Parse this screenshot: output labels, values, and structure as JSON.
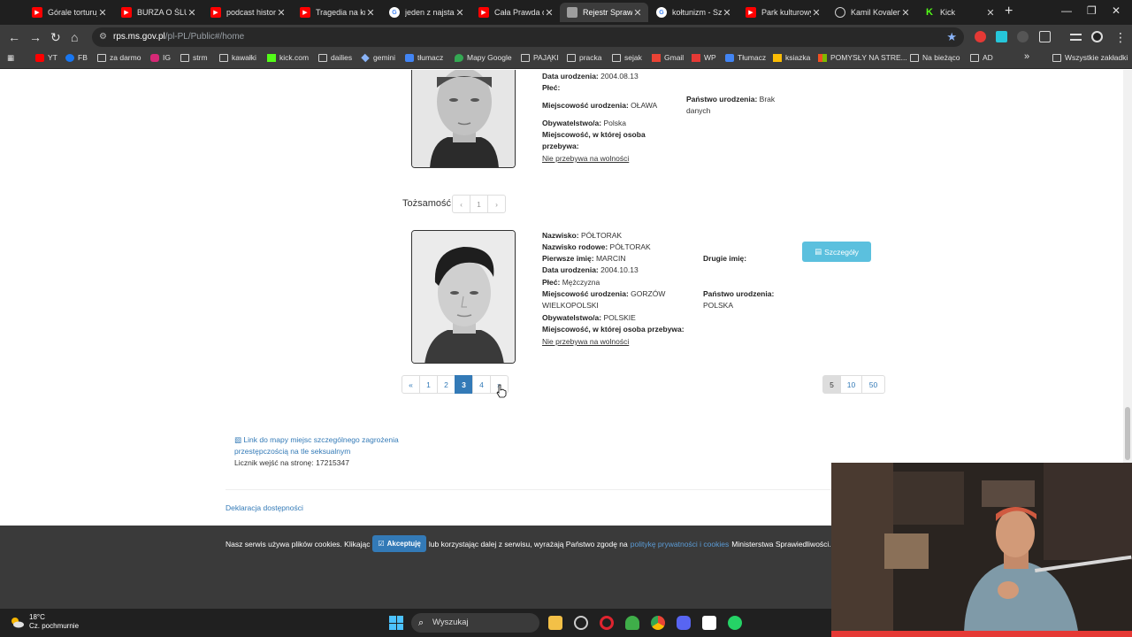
{
  "browser": {
    "tabs": [
      {
        "title": "Górale torturują",
        "icon": "youtube-icon",
        "active": false
      },
      {
        "title": "BURZA O ŚLUB",
        "icon": "youtube-icon",
        "active": false
      },
      {
        "title": "podcast historyczny",
        "icon": "youtube-icon",
        "active": false
      },
      {
        "title": "Tragedia na kru",
        "icon": "youtube-icon",
        "active": false
      },
      {
        "title": "jeden z najstar",
        "icon": "google-icon",
        "active": false
      },
      {
        "title": "Cała Prawda o",
        "icon": "youtube-icon",
        "active": false
      },
      {
        "title": "Rejestr Sprawc",
        "icon": "page-icon",
        "active": true
      },
      {
        "title": "kołtunizm - Sz",
        "icon": "google-icon",
        "active": false
      },
      {
        "title": "Park kulturowy",
        "icon": "youtube-icon",
        "active": false
      },
      {
        "title": "Kamil Kovalen",
        "icon": "globe-icon",
        "active": false
      },
      {
        "title": "Kick",
        "icon": "kick-icon",
        "active": false
      }
    ],
    "url_host": "rps.ms.gov.pl",
    "url_path": "/pl-PL/Public#/home",
    "bookmarks": [
      {
        "label": "YT",
        "icon": "youtube-icon"
      },
      {
        "label": "FB",
        "icon": "facebook-icon"
      },
      {
        "label": "za darmo",
        "icon": "folder-icon"
      },
      {
        "label": "IG",
        "icon": "instagram-icon"
      },
      {
        "label": "strm",
        "icon": "folder-icon"
      },
      {
        "label": "kawałki",
        "icon": "folder-icon"
      },
      {
        "label": "kick.com",
        "icon": "kick-icon"
      },
      {
        "label": "dailies",
        "icon": "folder-icon"
      },
      {
        "label": "gemini",
        "icon": "gemini-icon"
      },
      {
        "label": "tłumacz",
        "icon": "translate-icon"
      },
      {
        "label": "Mapy Google",
        "icon": "maps-icon"
      },
      {
        "label": "PAJĄKI",
        "icon": "folder-icon"
      },
      {
        "label": "pracka",
        "icon": "folder-icon"
      },
      {
        "label": "sejak",
        "icon": "folder-icon"
      },
      {
        "label": "Gmail",
        "icon": "gmail-icon"
      },
      {
        "label": "WP",
        "icon": "wp-icon"
      },
      {
        "label": "Tłumacz",
        "icon": "translate-icon"
      },
      {
        "label": "ksiazka",
        "icon": "book-icon"
      },
      {
        "label": "POMYSŁY NA STRE...",
        "icon": "microsoft-icon"
      },
      {
        "label": "Na bieżąco",
        "icon": "folder-icon"
      },
      {
        "label": "AD",
        "icon": "folder-icon"
      }
    ],
    "bookmarks_more": "»",
    "all_bookmarks": "Wszystkie zakładki"
  },
  "record1": {
    "birth_date_label": "Data urodzenia:",
    "birth_date": "2004.08.13",
    "sex_label": "Płeć:",
    "sex": "",
    "birth_place_label": "Miejscowość urodzenia:",
    "birth_place": "OŁAWA",
    "citizenship_label": "Obywatelstwo/a:",
    "citizenship": "Polska",
    "residence_label_1": "Miejscowość, w której osoba",
    "residence_label_2": "przebywa:",
    "freedom_link": "Nie przebywa na wolności",
    "birth_country_label": "Państwo urodzenia:",
    "birth_country_1": "Brak",
    "birth_country_2": "danych"
  },
  "identity": {
    "label": "Tożsamość:",
    "prev": "‹",
    "page": "1",
    "next": "›"
  },
  "record2": {
    "surname_label": "Nazwisko:",
    "surname": "PÓŁTORAK",
    "family_name_label": "Nazwisko rodowe:",
    "family_name": "PÓŁTORAK",
    "first_name_label": "Pierwsze imię:",
    "first_name": "MARCIN",
    "birth_date_label": "Data urodzenia:",
    "birth_date": "2004.10.13",
    "sex_label": "Płeć:",
    "sex": "Mężczyzna",
    "birth_place_label": "Miejscowość urodzenia:",
    "birth_place_1": "GORZÓW",
    "birth_place_2": "WIELKOPOLSKI",
    "citizenship_label": "Obywatelstwo/a:",
    "citizenship": "POLSKIE",
    "residence_label": "Miejscowość, w której osoba przebywa:",
    "freedom_link": "Nie przebywa na wolności",
    "second_name_label": "Drugie imię:",
    "birth_country_label": "Państwo urodzenia:",
    "birth_country": "POLSKA",
    "details_button": "Szczegóły"
  },
  "pagination": {
    "pages": [
      "«",
      "1",
      "2",
      "3",
      "4",
      "»"
    ],
    "active": "3",
    "page_sizes": [
      "5",
      "10",
      "50"
    ],
    "page_size_selected": "5"
  },
  "footer": {
    "map_link_1": "Link do mapy miejsc szczególnego zagrożenia",
    "map_link_2": "przestępczością na tle seksualnym",
    "counter_label": "Licznik wejść na stronę:",
    "counter": "17215347",
    "accessibility": "Deklaracja dostępności"
  },
  "cookies": {
    "text_before": "Nasz serwis używa plików cookies. Klikając",
    "accept": "Akceptuję",
    "text_middle": "lub korzystając dalej z serwisu, wyrażają Państwo zgodę na",
    "policy_link": "politykę prywatności i cookies",
    "text_after": "Ministerstwa Sprawiedliwości."
  },
  "taskbar": {
    "temperature": "18°C",
    "weather": "Cz. pochmurnie",
    "search_placeholder": "Wyszukaj"
  }
}
